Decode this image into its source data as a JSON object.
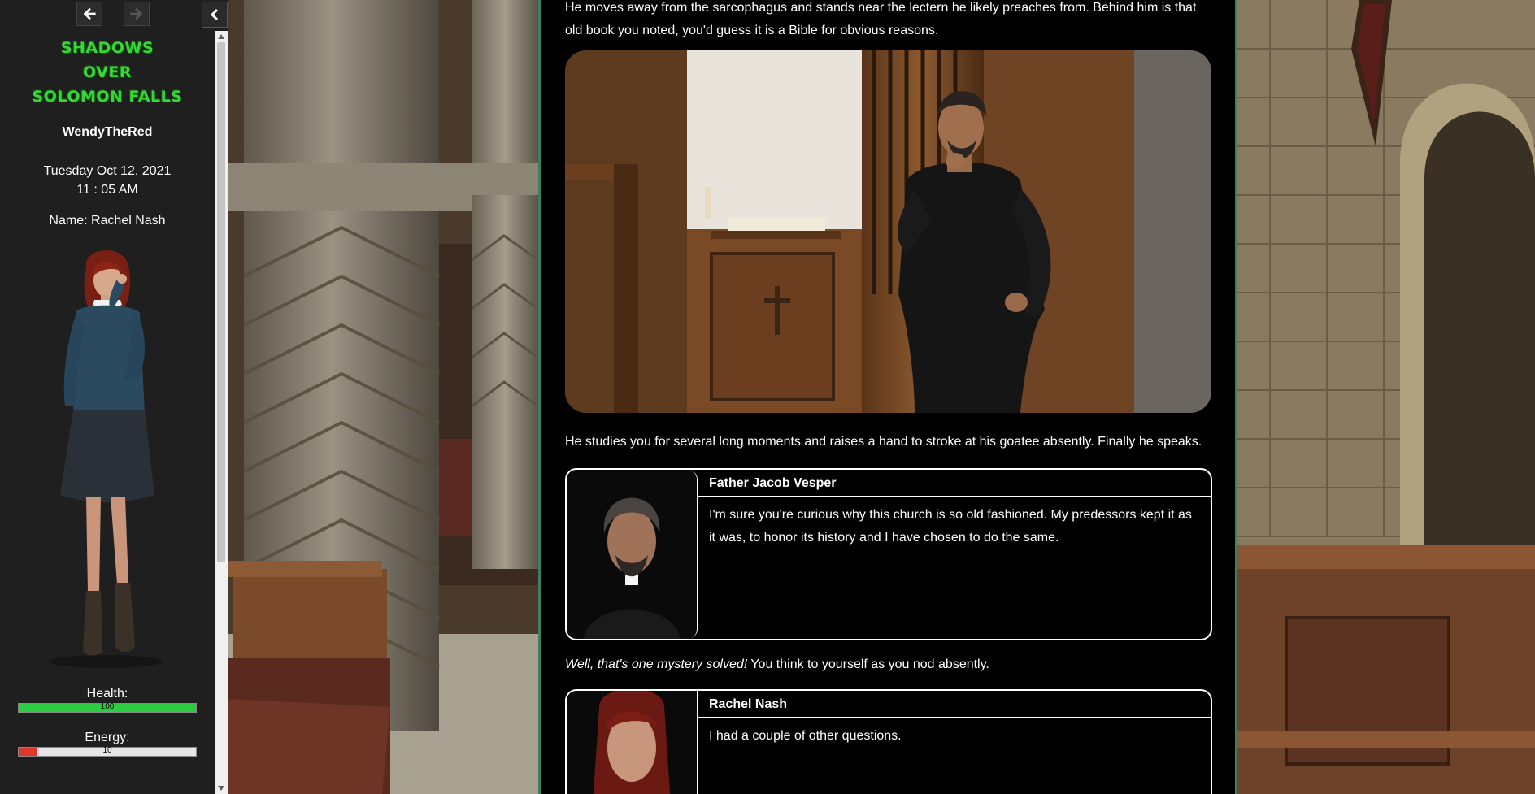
{
  "sidebar": {
    "title_lines": [
      "SHADOWS",
      "OVER",
      "SOLOMON FALLS"
    ],
    "author": "WendyTheRed",
    "date": "Tuesday Oct 12, 2021",
    "time": "11 : 05 AM",
    "name_line": "Name: Rachel Nash",
    "stats": {
      "health": {
        "label": "Health:",
        "value": 100,
        "max": 100,
        "color": "#2ecc40"
      },
      "energy": {
        "label": "Energy:",
        "value": 10,
        "max": 100,
        "color": "#e0362c"
      }
    }
  },
  "story": {
    "paragraph_1": "He moves away from the sarcophagus and stands near the lectern he likely preaches from. Behind him is that old book you noted, you'd guess it is a Bible for obvious reasons.",
    "paragraph_2": "He studies you for several long moments and raises a hand to stroke at his goatee absently. Finally he speaks.",
    "dialog_1": {
      "speaker": "Father Jacob Vesper",
      "text": "I'm sure you're curious why this church is so old fashioned. My predessors kept it as it was, to honor its history and I have chosen to do the same."
    },
    "paragraph_3_italic": "Well, that's one mystery solved!",
    "paragraph_3_rest": " You think to yourself as you nod absently.",
    "dialog_2": {
      "speaker": "Rachel Nash",
      "text": "I had a couple of other questions."
    }
  },
  "colors": {
    "title_green": "#3bd43b",
    "story_border": "#3f7f5a",
    "sidebar_bg": "#1f1f1f"
  },
  "icons": [
    "arrow-left-icon",
    "arrow-right-icon",
    "chevron-left-icon"
  ]
}
